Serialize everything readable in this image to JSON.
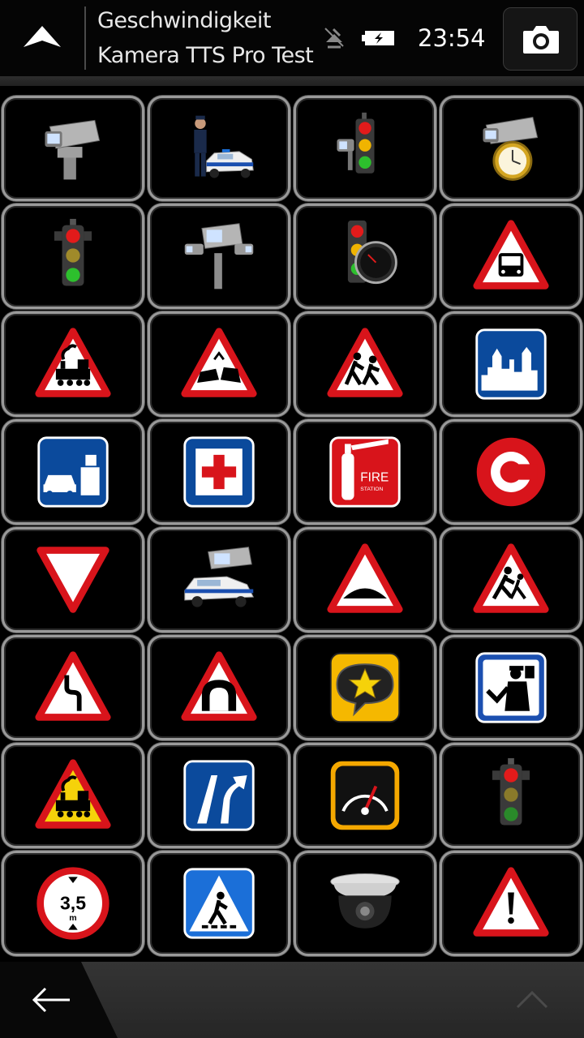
{
  "header": {
    "up_icon": "navigation-up-arrow-icon",
    "title_line1": "Geschwindigkeit",
    "title_line2": "Kamera TTS Pro Test",
    "gps_icon": "gps-no-signal-icon",
    "battery_icon": "battery-charging-icon",
    "time": "23:54",
    "camera_icon": "camera-icon"
  },
  "grid": {
    "columns": 4,
    "rows": 8,
    "icons": [
      "speed-camera-icon",
      "police-car-officer-icon",
      "traffic-light-camera-icon",
      "speed-camera-timer-icon",
      "traffic-light-icon",
      "section-control-camera-icon",
      "traffic-light-speed-icon",
      "bus-warning-sign-icon",
      "railway-crossing-sign-icon",
      "accident-sign-icon",
      "school-children-sign-icon",
      "city-zone-sign-icon",
      "toll-booth-sign-icon",
      "hospital-sign-icon",
      "fire-station-sign-icon",
      "congestion-charge-sign-icon",
      "give-way-sign-icon",
      "police-car-camera-icon",
      "speed-bump-sign-icon",
      "children-playing-sign-icon",
      "double-bend-sign-icon",
      "tunnel-sign-icon",
      "favorite-star-icon",
      "police-checkpoint-sign-icon",
      "railway-crossing-yellow-sign-icon",
      "lane-merge-sign-icon",
      "speedometer-icon",
      "traffic-light-dark-icon",
      "height-limit-sign-icon",
      "pedestrian-crossing-sign-icon",
      "dome-camera-icon",
      "danger-warning-sign-icon"
    ]
  },
  "height_limit": {
    "value": "3,5",
    "unit": "m"
  },
  "fire_station": {
    "line1": "FIRE",
    "line2": "STATION"
  },
  "bottom": {
    "back_icon": "back-arrow-icon",
    "scroll_up_icon": "chevron-up-icon"
  },
  "colors": {
    "sign_red": "#d8141b",
    "sign_blue": "#0b4a9c",
    "sign_yellow": "#f5d20a",
    "tile_border": "#9a9a9a"
  }
}
